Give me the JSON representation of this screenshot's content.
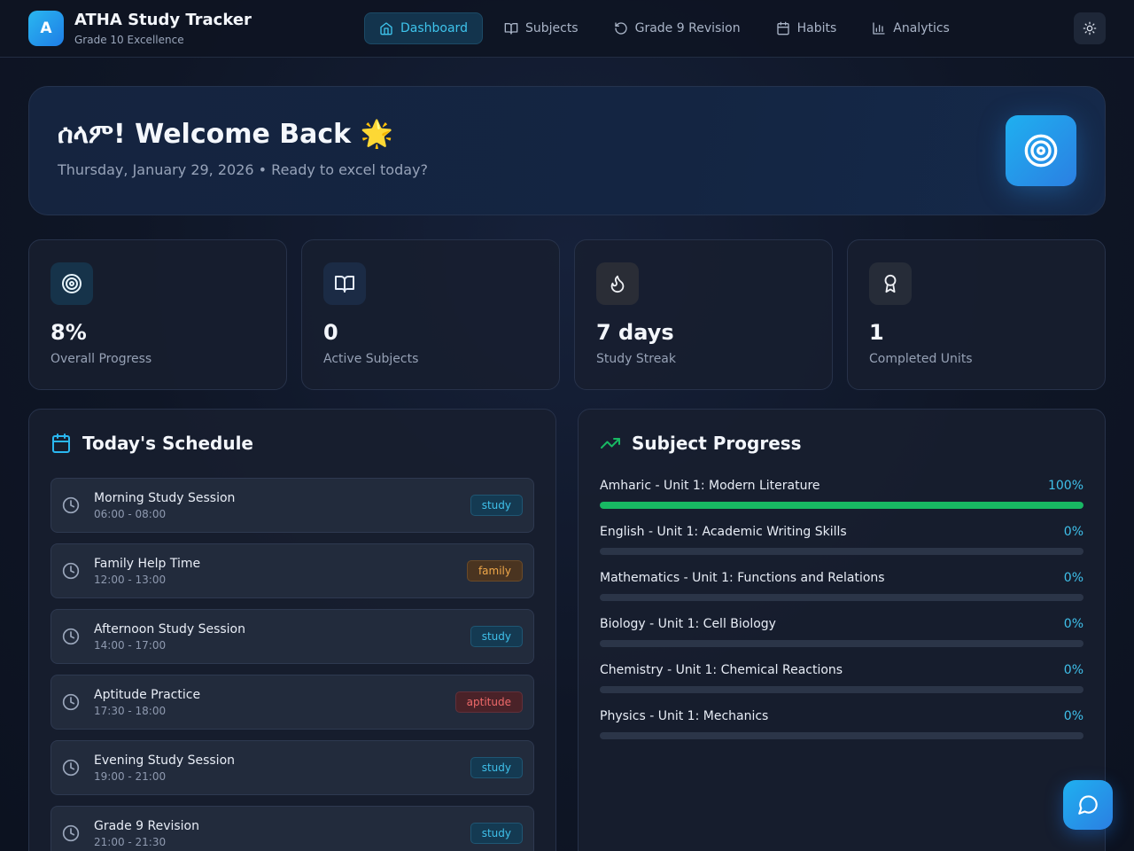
{
  "app": {
    "logo_letter": "A",
    "title": "ATHA Study Tracker",
    "subtitle": "Grade 10 Excellence"
  },
  "nav": [
    {
      "label": "Dashboard",
      "icon": "home-icon",
      "active": true
    },
    {
      "label": "Subjects",
      "icon": "book-open-icon",
      "active": false
    },
    {
      "label": "Grade 9 Revision",
      "icon": "rotate-ccw-icon",
      "active": false
    },
    {
      "label": "Habits",
      "icon": "calendar-icon",
      "active": false
    },
    {
      "label": "Analytics",
      "icon": "bar-chart-icon",
      "active": false
    }
  ],
  "hero": {
    "title": "ሰላም! Welcome Back 🌟",
    "subtitle": "Thursday, January 29, 2026 • Ready to excel today?"
  },
  "stats": [
    {
      "value": "8%",
      "label": "Overall Progress",
      "icon": "target-icon",
      "color": "#2ab7f0"
    },
    {
      "value": "0",
      "label": "Active Subjects",
      "icon": "book-open-icon",
      "color": "#60a5fa"
    },
    {
      "value": "7 days",
      "label": "Study Streak",
      "icon": "flame-icon",
      "color": "#e5e7eb"
    },
    {
      "value": "1",
      "label": "Completed Units",
      "icon": "award-icon",
      "color": "#e5e7eb"
    }
  ],
  "schedule": {
    "title": "Today's Schedule",
    "items": [
      {
        "name": "Morning Study Session",
        "time": "06:00 - 08:00",
        "tag": "study"
      },
      {
        "name": "Family Help Time",
        "time": "12:00 - 13:00",
        "tag": "family"
      },
      {
        "name": "Afternoon Study Session",
        "time": "14:00 - 17:00",
        "tag": "study"
      },
      {
        "name": "Aptitude Practice",
        "time": "17:30 - 18:00",
        "tag": "aptitude"
      },
      {
        "name": "Evening Study Session",
        "time": "19:00 - 21:00",
        "tag": "study"
      },
      {
        "name": "Grade 9 Revision",
        "time": "21:00 - 21:30",
        "tag": "study"
      }
    ]
  },
  "progress": {
    "title": "Subject Progress",
    "items": [
      {
        "name": "Amharic - Unit 1: Modern Literature",
        "pct_label": "100%",
        "value": 100
      },
      {
        "name": "English - Unit 1: Academic Writing Skills",
        "pct_label": "0%",
        "value": 0
      },
      {
        "name": "Mathematics - Unit 1: Functions and Relations",
        "pct_label": "0%",
        "value": 0
      },
      {
        "name": "Biology - Unit 1: Cell Biology",
        "pct_label": "0%",
        "value": 0
      },
      {
        "name": "Chemistry - Unit 1: Chemical Reactions",
        "pct_label": "0%",
        "value": 0
      },
      {
        "name": "Physics - Unit 1: Mechanics",
        "pct_label": "0%",
        "value": 0
      }
    ]
  },
  "colors": {
    "accent": "#3ec4ec",
    "progress_fill": "#18b863",
    "schedule_icon": "#2ab7f0",
    "progress_icon": "#18b863"
  }
}
